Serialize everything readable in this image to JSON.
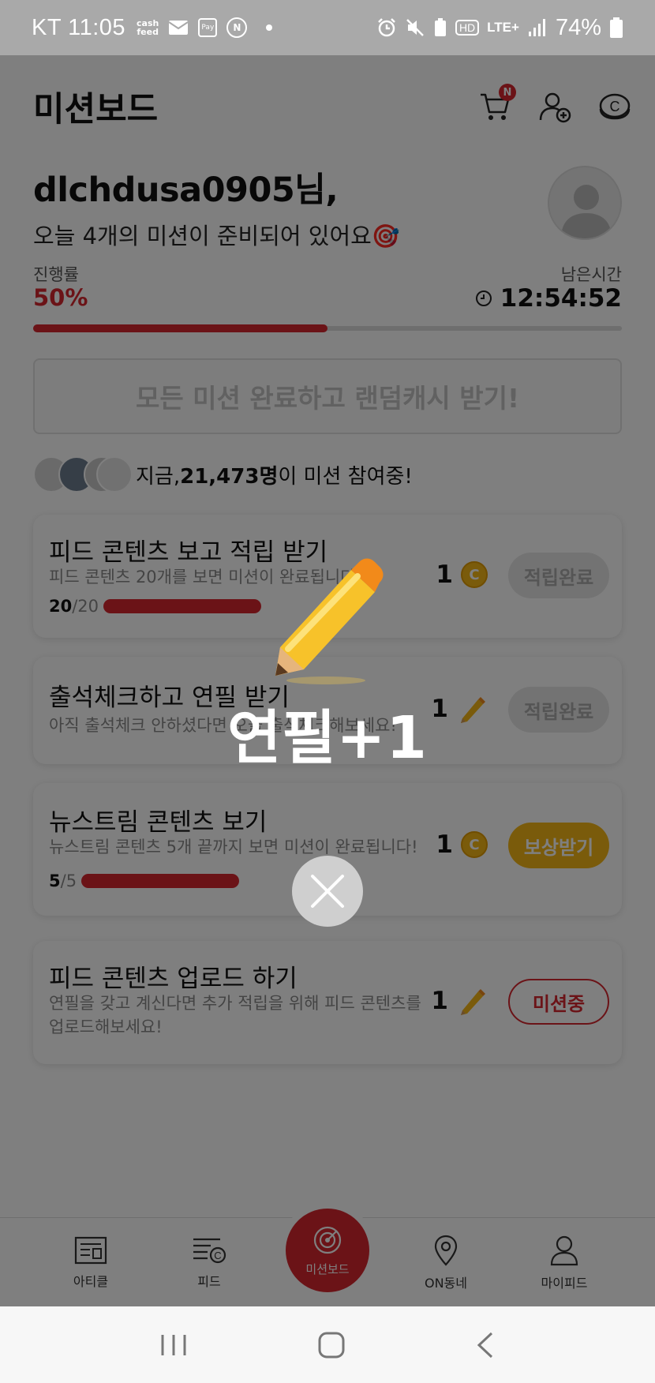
{
  "status_bar": {
    "carrier_time": "KT 11:05",
    "left_icons": [
      "cashfeed-icon",
      "mail-icon",
      "samsung-pay-icon",
      "n-circle-icon",
      "dot"
    ],
    "cashfeed_label_top": "cash",
    "cashfeed_label_bottom": "feed",
    "samsung_pay_label": "Pay",
    "n_label": "N",
    "right_icons": [
      "alarm-icon",
      "mute-icon",
      "battery-saver-icon",
      "hd-icon",
      "lte-icon",
      "signal-icon",
      "battery-icon"
    ],
    "hd_label": "HD",
    "lte_label": "LTE+",
    "battery_percent": "74%"
  },
  "header": {
    "title": "미션보드",
    "cart_badge": "N",
    "coin_symbol": "C"
  },
  "greeting": {
    "username": "dlchdusa0905님,",
    "subtitle": "오늘 4개의 미션이 준비되어 있어요🎯"
  },
  "progress": {
    "label": "진행률",
    "value": "50%",
    "fraction": 0.5,
    "remaining_label": "남은시간",
    "remaining_time": "12:54:52"
  },
  "all_complete_button": "모든 미션 완료하고 랜덤캐시 받기!",
  "participants": {
    "prefix": "지금, ",
    "count": "21,473명",
    "suffix": "이 미션 참여중!"
  },
  "missions": [
    {
      "title": "피드 콘텐츠 보고 적립 받기",
      "desc": "피드 콘텐츠 20개를 보면 미션이 완료됩니다!",
      "progress_current": "20",
      "progress_total": "/20",
      "progress_fraction": 1.0,
      "reward_amount": "1",
      "reward_type": "coin",
      "status": "적립완료"
    },
    {
      "title": "출석체크하고 연필 받기",
      "desc": "아직 출석체크 안하셨다면 오늘 출석체크해보세요!",
      "reward_amount": "1",
      "reward_type": "pencil",
      "status": "적립완료"
    },
    {
      "title": "뉴스트림 콘텐츠 보기",
      "desc": "뉴스트림 콘텐츠 5개 끝까지 보면 미션이 완료됩니다!",
      "progress_current": "5",
      "progress_total": "/5",
      "progress_fraction": 1.0,
      "reward_amount": "1",
      "reward_type": "coin",
      "status": "보상받기"
    },
    {
      "title": "피드 콘텐츠 업로드 하기",
      "desc": "연필을 갖고 계신다면 추가 적립을 위해 피드 콘텐츠를 업로드해보세요!",
      "reward_amount": "1",
      "reward_type": "pencil",
      "status": "미션중"
    }
  ],
  "bottom_nav": [
    {
      "label": "아티클",
      "icon": "article-icon"
    },
    {
      "label": "피드",
      "icon": "feed-icon"
    },
    {
      "label": "미션보드",
      "icon": "target-icon"
    },
    {
      "label": "ON동네",
      "icon": "location-pin-icon"
    },
    {
      "label": "마이피드",
      "icon": "person-icon"
    }
  ],
  "overlay": {
    "message": "연필+1",
    "icon": "pencil-icon"
  },
  "colors": {
    "accent_red": "#d7262f",
    "coin_yellow": "#f5b617",
    "overlay": "rgba(0,0,0,0.5)"
  }
}
